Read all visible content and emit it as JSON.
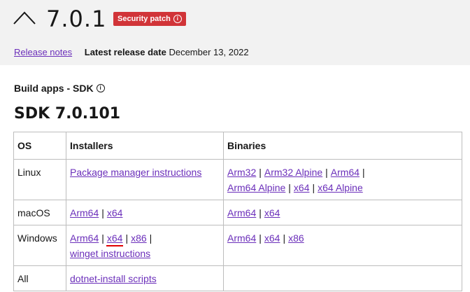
{
  "header": {
    "version": "7.0.1",
    "badge": "Security patch",
    "release_notes": "Release notes",
    "latest_label": "Latest release date",
    "latest_date": "December 13, 2022"
  },
  "section": {
    "title": "Build apps - SDK",
    "sdk_title": "SDK 7.0.101"
  },
  "table": {
    "headers": [
      "OS",
      "Installers",
      "Binaries"
    ],
    "rows": [
      {
        "os": "Linux",
        "installers": [
          "Package manager instructions"
        ],
        "binaries": [
          "Arm32",
          "Arm32 Alpine",
          "Arm64",
          "Arm64 Alpine",
          "x64",
          "x64 Alpine"
        ]
      },
      {
        "os": "macOS",
        "installers": [
          "Arm64",
          "x64"
        ],
        "binaries": [
          "Arm64",
          "x64"
        ]
      },
      {
        "os": "Windows",
        "installers": [
          "Arm64",
          "x64",
          "x86",
          "winget instructions"
        ],
        "binaries": [
          "Arm64",
          "x64",
          "x86"
        ]
      },
      {
        "os": "All",
        "installers": [
          "dotnet-install scripts"
        ],
        "binaries": []
      }
    ]
  },
  "colors": {
    "link": "#6b2fba",
    "badge": "#d13438",
    "selection_underline": "#e00000"
  }
}
